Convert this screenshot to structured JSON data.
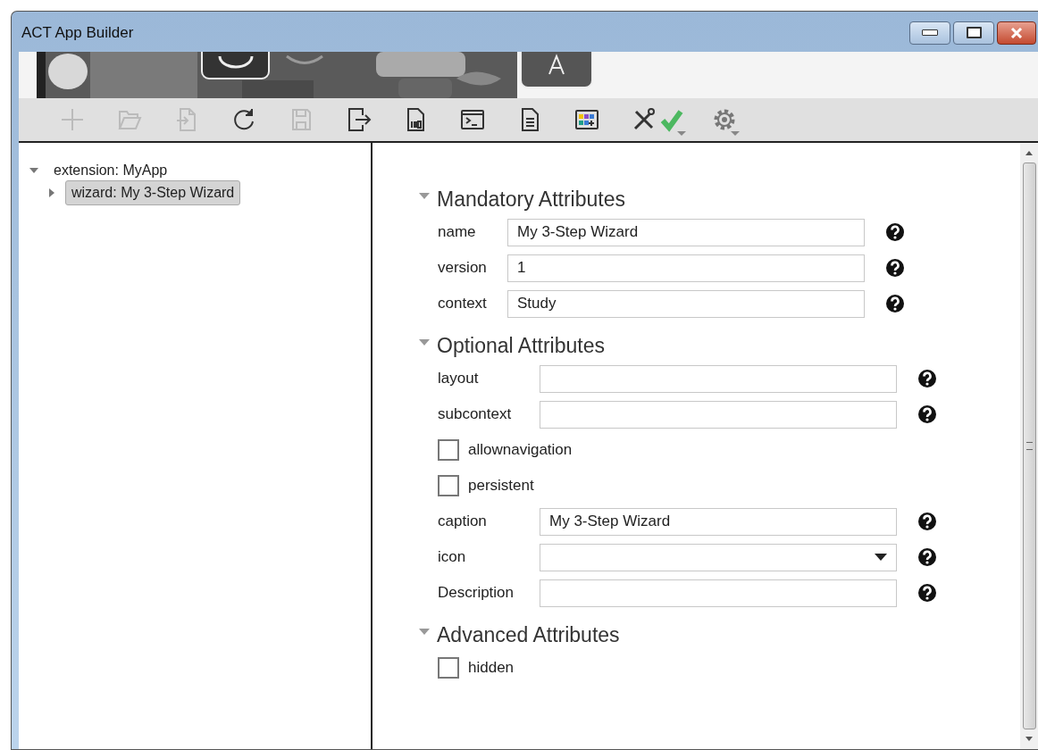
{
  "window": {
    "title": "ACT App Builder"
  },
  "toolbar": [
    {
      "kind": "add",
      "disabled": true
    },
    {
      "kind": "open",
      "disabled": true
    },
    {
      "kind": "import",
      "disabled": true
    },
    {
      "kind": "refresh",
      "disabled": false
    },
    {
      "kind": "save",
      "disabled": true
    },
    {
      "kind": "export",
      "disabled": false
    },
    {
      "kind": "binary",
      "disabled": false
    },
    {
      "kind": "console",
      "disabled": false
    },
    {
      "kind": "document",
      "disabled": false
    },
    {
      "kind": "palette",
      "disabled": false
    },
    {
      "kind": "tools",
      "disabled": false
    }
  ],
  "toolbar_right": [
    {
      "kind": "check"
    },
    {
      "kind": "settings"
    }
  ],
  "tree": [
    {
      "label": "extension: MyApp",
      "expanded": true,
      "selected": false,
      "children": [
        {
          "label": "wizard: My 3-Step Wizard",
          "expanded": false,
          "selected": true
        }
      ]
    }
  ],
  "sections": [
    {
      "title": "Mandatory Attributes",
      "expanded": true,
      "fields": [
        {
          "kind": "text",
          "label": "name",
          "value": "My 3-Step Wizard"
        },
        {
          "kind": "text",
          "label": "version",
          "value": "1"
        },
        {
          "kind": "text",
          "label": "context",
          "value": "Study"
        }
      ]
    },
    {
      "title": "Optional Attributes",
      "expanded": true,
      "fields": [
        {
          "kind": "text",
          "label": "layout"
        },
        {
          "kind": "text",
          "label": "subcontext"
        },
        {
          "kind": "checkbox",
          "label": "allownavigation",
          "checked": false
        },
        {
          "kind": "checkbox",
          "label": "persistent",
          "checked": false
        },
        {
          "kind": "text",
          "label": "caption",
          "value": "My 3-Step Wizard"
        },
        {
          "kind": "dropdown",
          "label": "icon"
        },
        {
          "kind": "text",
          "label": "Description"
        }
      ]
    },
    {
      "title": "Advanced Attributes",
      "expanded": true,
      "fields": [
        {
          "kind": "checkbox",
          "label": "hidden",
          "checked": false
        }
      ]
    }
  ]
}
